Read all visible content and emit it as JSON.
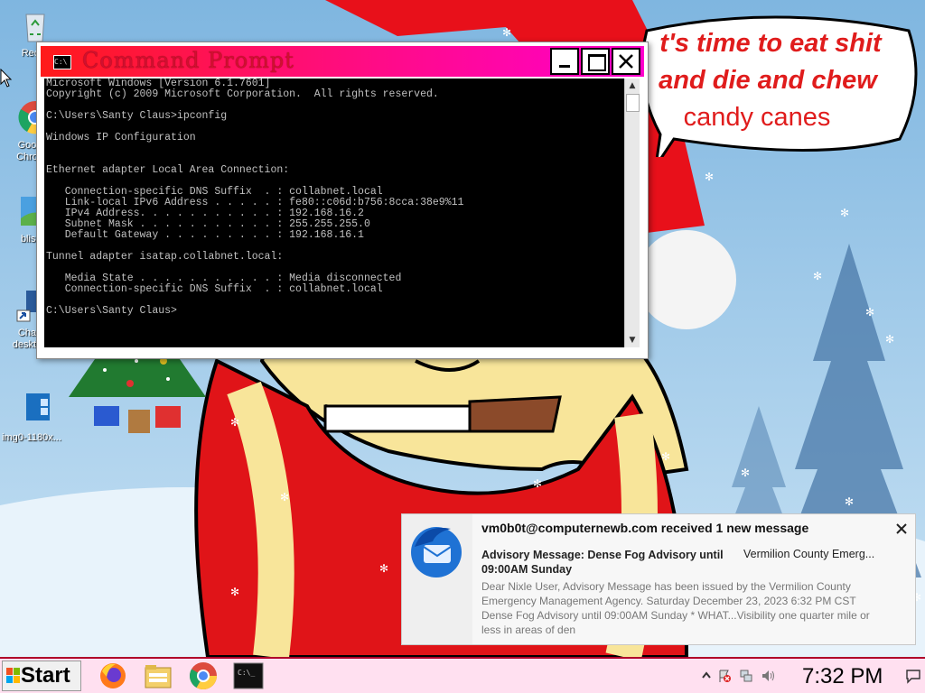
{
  "desktop": {
    "icons": [
      {
        "label": "Recyc",
        "icon": "recycle-bin-icon"
      },
      {
        "label": "Goo Chro",
        "icon": "chrome-icon"
      },
      {
        "label": "blissh",
        "icon": "image-file-icon"
      },
      {
        "label": "Cha deskto",
        "icon": "shortcut-icon"
      },
      {
        "label": "img0-1180x...",
        "icon": "image-file-icon"
      }
    ]
  },
  "cmd": {
    "title": "Command Prompt",
    "output": "Microsoft Windows [Version 6.1.7601]\nCopyright (c) 2009 Microsoft Corporation.  All rights reserved.\n\nC:\\Users\\Santy Claus>ipconfig\n\nWindows IP Configuration\n\n\nEthernet adapter Local Area Connection:\n\n   Connection-specific DNS Suffix  . : collabnet.local\n   Link-local IPv6 Address . . . . . : fe80::c06d:b756:8cca:38e9%11\n   IPv4 Address. . . . . . . . . . . : 192.168.16.2\n   Subnet Mask . . . . . . . . . . . : 255.255.255.0\n   Default Gateway . . . . . . . . . : 192.168.16.1\n\nTunnel adapter isatap.collabnet.local:\n\n   Media State . . . . . . . . . . . : Media disconnected\n   Connection-specific DNS Suffix  . : collabnet.local\n\nC:\\Users\\Santy Claus>"
  },
  "wallpaper": {
    "speech_bubble": {
      "line1": "t's time to eat shit",
      "line2": "and die and chew",
      "line3": "candy canes"
    }
  },
  "notification": {
    "title": "vm0b0t@computernewb.com received 1 new message",
    "subject": "Advisory Message: Dense Fog Advisory until 09:00AM Sunday",
    "sender": "Vermilion County Emerg...",
    "body": "Dear Nixle User, Advisory Message has been issued by the Vermilion County Emergency Management Agency. Saturday December 23, 2023 6:32 PM CST Dense Fog Advisory until 09:00AM Sunday * WHAT...Visibility one quarter mile or less in areas of den",
    "app_icon": "thunderbird-icon"
  },
  "taskbar": {
    "start_label": "Start",
    "pinned": [
      "firefox-icon",
      "file-explorer-icon",
      "chrome-icon",
      "command-prompt-icon"
    ],
    "clock": "7:32 PM",
    "tray": [
      "show-hidden-icons-chevron",
      "action-center-flag-icon",
      "network-icon",
      "volume-icon"
    ]
  },
  "colors": {
    "titlebar_start": "#ff1a1a",
    "titlebar_end": "#ff00cc",
    "title_text": "#d01030",
    "taskbar_bg": "#ffe0f0",
    "bubble_text": "#e01c1c"
  }
}
